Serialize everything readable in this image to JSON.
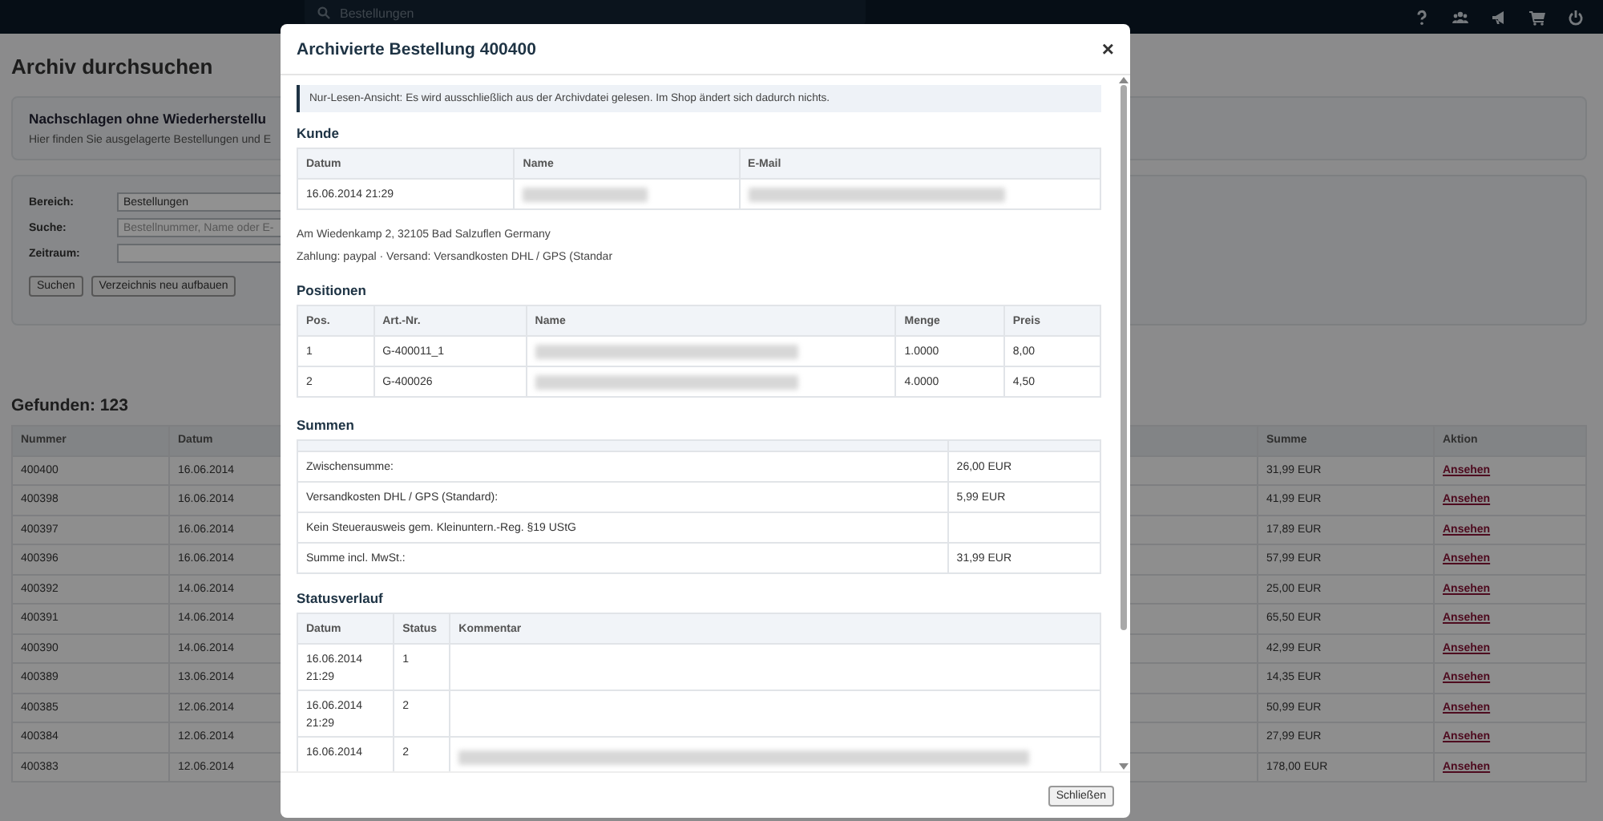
{
  "topbar": {
    "search_placeholder": "Bestellungen"
  },
  "page": {
    "title": "Archiv durchsuchen",
    "info_card": {
      "heading": "Nachschlagen ohne Wiederherstellu",
      "text": "Hier finden Sie ausgelagerte Bestellungen und E"
    },
    "form": {
      "fields": [
        {
          "label": "Bereich:",
          "kind": "select",
          "value": "Bestellungen"
        },
        {
          "label": "Suche:",
          "kind": "text",
          "placeholder": "Bestellnummer, Name oder E-"
        },
        {
          "label": "Zeitraum:",
          "kind": "text"
        }
      ],
      "buttons": [
        "Suchen",
        "Verzeichnis neu aufbauen"
      ]
    },
    "results": {
      "heading": "Gefunden: 123",
      "columns": [
        "Nummer",
        "Datum",
        "Summe",
        "Aktion"
      ],
      "rows": [
        {
          "nummer": "400400",
          "datum": "16.06.2014",
          "summe": "31,99 EUR",
          "aktion": "Ansehen"
        },
        {
          "nummer": "400398",
          "datum": "16.06.2014",
          "summe": "41,99 EUR",
          "aktion": "Ansehen"
        },
        {
          "nummer": "400397",
          "datum": "16.06.2014",
          "summe": "17,89 EUR",
          "aktion": "Ansehen"
        },
        {
          "nummer": "400396",
          "datum": "16.06.2014",
          "summe": "57,99 EUR",
          "aktion": "Ansehen"
        },
        {
          "nummer": "400392",
          "datum": "14.06.2014",
          "summe": "25,00 EUR",
          "aktion": "Ansehen"
        },
        {
          "nummer": "400391",
          "datum": "14.06.2014",
          "summe": "65,50 EUR",
          "aktion": "Ansehen"
        },
        {
          "nummer": "400390",
          "datum": "14.06.2014",
          "summe": "42,99 EUR",
          "aktion": "Ansehen"
        },
        {
          "nummer": "400389",
          "datum": "13.06.2014",
          "summe": "14,35 EUR",
          "aktion": "Ansehen"
        },
        {
          "nummer": "400385",
          "datum": "12.06.2014",
          "summe": "50,99 EUR",
          "aktion": "Ansehen"
        },
        {
          "nummer": "400384",
          "datum": "12.06.2014",
          "summe": "27,99 EUR",
          "aktion": "Ansehen"
        },
        {
          "nummer": "400383",
          "datum": "12.06.2014",
          "summe": "178,00 EUR",
          "aktion": "Ansehen"
        }
      ]
    }
  },
  "dialog": {
    "title": "Archivierte Bestellung 400400",
    "close": "×",
    "notice": "Nur-Lesen-Ansicht: Es wird ausschließlich aus der Archivdatei gelesen. Im Shop ändert sich dadurch nichts.",
    "kunde": {
      "heading": "Kunde",
      "columns": [
        "Datum",
        "Name",
        "E-Mail"
      ],
      "rows": [
        [
          {
            "kind": "text",
            "text": "16.06.2014 21:29"
          },
          {
            "kind": "blurred"
          },
          {
            "kind": "blurred"
          }
        ]
      ],
      "lines": [
        "Am Wiedenkamp 2, 32105 Bad Salzuflen Germany",
        "Zahlung: paypal · Versand: Versandkosten DHL / GPS (Standar"
      ]
    },
    "positionen": {
      "heading": "Positionen",
      "columns": [
        "Pos.",
        "Art.-Nr.",
        "Name",
        "Menge",
        "Preis"
      ],
      "rows": [
        [
          {
            "kind": "text",
            "text": "1"
          },
          {
            "kind": "text",
            "text": "G-400011_1"
          },
          {
            "kind": "blurred"
          },
          {
            "kind": "text",
            "text": "1.0000"
          },
          {
            "kind": "text",
            "text": "8,00"
          }
        ],
        [
          {
            "kind": "text",
            "text": "2"
          },
          {
            "kind": "text",
            "text": "G-400026"
          },
          {
            "kind": "blurred"
          },
          {
            "kind": "text",
            "text": "4.0000"
          },
          {
            "kind": "text",
            "text": "4,50"
          }
        ]
      ]
    },
    "summen": {
      "heading": "Summen",
      "rows": [
        {
          "label": "Zwischensumme:",
          "value": "26,00 EUR"
        },
        {
          "label": "Versandkosten DHL / GPS (Standard):",
          "value": "5,99 EUR"
        },
        {
          "label": "Kein Steuerausweis gem. Kleinuntern.-Reg. §19 UStG"
        },
        {
          "label": "Summe incl. MwSt.:",
          "value": "31,99 EUR"
        }
      ]
    },
    "status": {
      "heading": "Statusverlauf",
      "columns": [
        "Datum",
        "Status",
        "Kommentar"
      ],
      "rows": [
        [
          {
            "kind": "text",
            "text": "16.06.2014 21:29"
          },
          {
            "kind": "text",
            "text": "1"
          },
          {
            "kind": "empty"
          }
        ],
        [
          {
            "kind": "text",
            "text": "16.06.2014 21:29"
          },
          {
            "kind": "text",
            "text": "2"
          },
          {
            "kind": "empty"
          }
        ],
        [
          {
            "kind": "text",
            "text": "16.06.2014"
          },
          {
            "kind": "text",
            "text": "2"
          },
          {
            "kind": "blurred"
          }
        ]
      ]
    },
    "close_button": "Schließen"
  }
}
